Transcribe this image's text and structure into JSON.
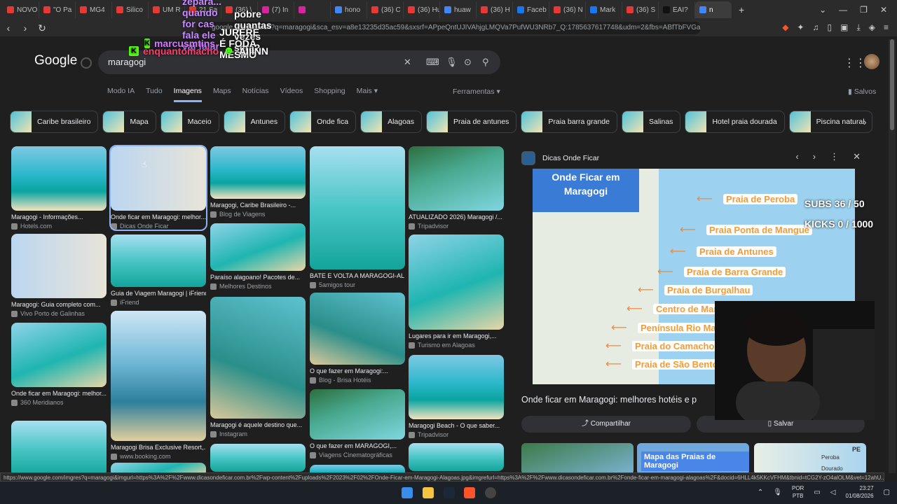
{
  "browser": {
    "tabs": [
      {
        "label": "NOVO",
        "color": "#e53935"
      },
      {
        "label": "\"O Pa",
        "color": "#e53935"
      },
      {
        "label": "MG4",
        "color": "#e53935"
      },
      {
        "label": "Silico",
        "color": "#e53935"
      },
      {
        "label": "UM R",
        "color": "#e53935"
      },
      {
        "label": "21 Sa",
        "color": "#e53935"
      },
      {
        "label": "(36) \\",
        "color": "#e53935"
      },
      {
        "label": "(7) In",
        "color": "#d6249f"
      },
      {
        "label": "",
        "color": "#d6249f"
      },
      {
        "label": "hono",
        "color": "#4285f4"
      },
      {
        "label": "(36) C",
        "color": "#e53935"
      },
      {
        "label": "(36) Hu",
        "color": "#e53935"
      },
      {
        "label": "huaw",
        "color": "#4285f4"
      },
      {
        "label": "(36) H",
        "color": "#e53935"
      },
      {
        "label": "Faceb",
        "color": "#1877f2"
      },
      {
        "label": "(36) N",
        "color": "#e53935"
      },
      {
        "label": "Mark",
        "color": "#1877f2"
      },
      {
        "label": "(36) S",
        "color": "#e53935"
      },
      {
        "label": "EAI?",
        "color": "#111111"
      },
      {
        "label": "n",
        "color": "#4285f4"
      }
    ],
    "url": "google.com/search?q=maragogi&sca_esv=a8e13235d35ac59&sxsrf=APpeQntUJIVAhjgLMQVa7PufWU3NRb7_Q:1785637617748&udm=2&fbs=ABfTbFVGaQea..."
  },
  "chat": {
    "top_line": "pobre quantas vezes sera?",
    "top_prefix": "zepara...  quando for cas fala ele vai falar",
    "messages": [
      {
        "user": "marcusmtins",
        "text": "JURERE É FODA MESMO"
      },
      {
        "user": "enquantomacho",
        "text": "AIIINN"
      }
    ]
  },
  "google": {
    "logo": "Google",
    "query": "maragogi",
    "tabs": [
      "Modo IA",
      "Tudo",
      "Imagens",
      "Maps",
      "Notícias",
      "Vídeos",
      "Shopping",
      "Mais"
    ],
    "active_tab": "Imagens",
    "tools": "Ferramentas",
    "saved": "Salvos",
    "chips": [
      "Caribe brasileiro",
      "Mapa",
      "Maceio",
      "Antunes",
      "Onde fica",
      "Alagoas",
      "Praia de antunes",
      "Praia barra grande",
      "Salinas",
      "Hotel praia dourada",
      "Piscina natural"
    ]
  },
  "results": {
    "col1": [
      {
        "title": "Maragogi - Informações...",
        "source": "Hotels.com"
      },
      {
        "title": "Maragogi: Guia completo com...",
        "source": "Vivo Porto de Galinhas"
      },
      {
        "title": "Onde ficar em Maragogi: melhor...",
        "source": "360 Meridianos"
      }
    ],
    "col2": [
      {
        "title": "Onde ficar em Maragogi: melhor...",
        "source": "Dicas Onde Ficar"
      },
      {
        "title": "Guia de Viagem Maragogi | iFriend",
        "source": "iFriend"
      },
      {
        "title": "Maragogi Brisa Exclusive Resort,...",
        "source": "www.booking.com"
      }
    ],
    "col3": [
      {
        "title": "Maragogi, Caribe Brasileiro -...",
        "source": "Blog de Viagens"
      },
      {
        "title": "Paraíso alagoano! Pacotes de...",
        "source": "Melhores Destinos"
      },
      {
        "title": "Maragogi é aquele destino que...",
        "source": "Instagram"
      }
    ],
    "col4": [
      {
        "title": "BATE E VOLTA A MARAGOGI-AL ...",
        "source": "5amigos tour"
      },
      {
        "title": "O que fazer em Maragogi:...",
        "source": "Blog - Brisa Hotéis"
      },
      {
        "title": "O que fazer em MARAGOGI,...",
        "source": "Viagens Cinematográficas"
      }
    ],
    "col5": [
      {
        "title": "ATUALIZADO 2026) Maragogi /...",
        "source": "Tripadvisor"
      },
      {
        "title": "Lugares para ir em Maragogi,...",
        "source": "Turismo em Alagoas"
      },
      {
        "title": "Maragogi Beach - O que saber...",
        "source": "Tripadvisor"
      }
    ]
  },
  "panel": {
    "source": "Dicas Onde Ficar",
    "map_title": "Onde Ficar em Maragogi",
    "beaches": [
      "Praia de Peroba",
      "Praia Ponta de Mangue",
      "Praia de Antunes",
      "Praia de Barra Grande",
      "Praia de Burgalhau",
      "Centro de Maragogi (Praia de Maragogi)",
      "Península Rio Maragogi",
      "Praia do Camacho",
      "Praia de São Bento"
    ],
    "title": "Onde ficar em Maragogi: melhores hotéis e p",
    "share": "Compartilhar",
    "save": "Salvar",
    "related_label": "Mapa das Praias de Maragogi",
    "related_pe": "PE",
    "related_peroba": "Peroba",
    "related_dourado": "Dourado"
  },
  "stream": {
    "subs": "SUBS 36 / 50",
    "kicks": "KICKS 0 / 1000"
  },
  "status_url": "https://www.google.com/imgres?q=maragogi&imgurl=https%3A%2F%2Fwww.dicasondeficar.com.br%2Fwp-content%2Fuploads%2F2023%2F02%2FOnde-Ficar-em-Maragogi-Alagoas.jpg&imgrefurl=https%3A%2F%2Fwww.dicasondeficar.com.br%2Fonde-ficar-em-maragogi-alagoas%2F&docid=6HLL4k5KKcVFHM&tbnid=tCG2Y-zO4alOLM&vet=12ahU...",
  "taskbar": {
    "lang_top": "POR",
    "lang_bottom": "PTB",
    "time": "23:27",
    "date": "01/08/2026"
  }
}
